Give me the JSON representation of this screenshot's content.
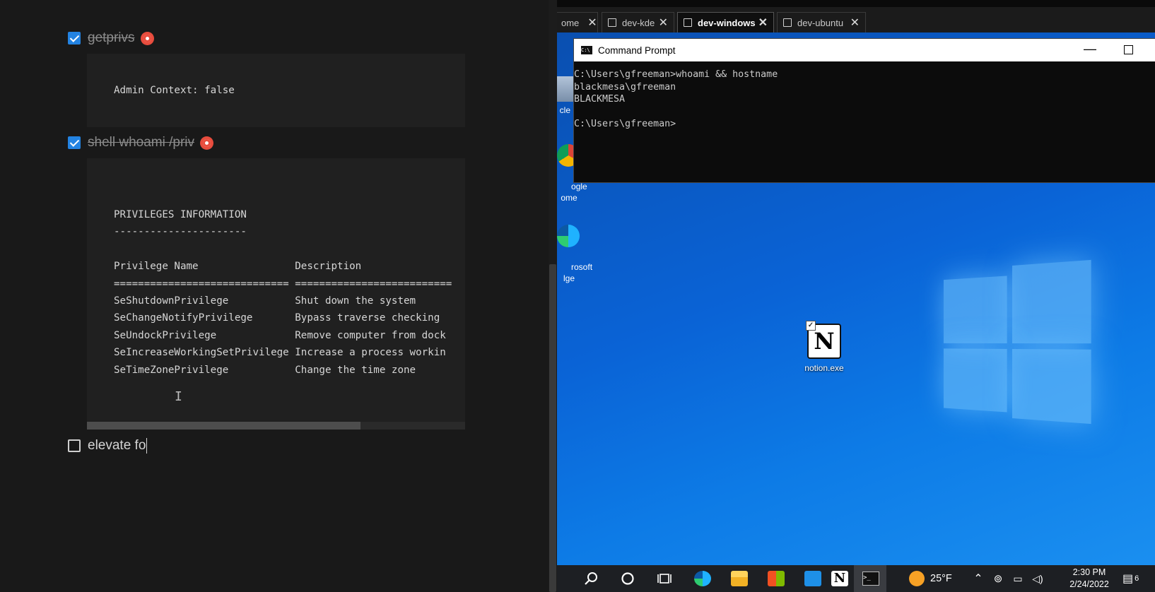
{
  "notes": {
    "todos": [
      {
        "label": "getprivs",
        "checked": true
      },
      {
        "label": "shell whoami /priv",
        "checked": true
      },
      {
        "label": "elevate fo",
        "checked": false
      }
    ],
    "code1": "Admin Context: false",
    "code2": "PRIVILEGES INFORMATION\n----------------------\n\nPrivilege Name                Description\n============================= ==========================\nSeShutdownPrivilege           Shut down the system\nSeChangeNotifyPrivilege       Bypass traverse checking\nSeUndockPrivilege             Remove computer from dock\nSeIncreaseWorkingSetPrivilege Increase a process workin\nSeTimeZonePrivilege           Change the time zone"
  },
  "vm": {
    "tabs": [
      {
        "label": "ome"
      },
      {
        "label": "dev-kde"
      },
      {
        "label": "dev-windows",
        "active": true
      },
      {
        "label": "dev-ubuntu"
      }
    ],
    "cmd": {
      "title": "Command Prompt",
      "output": "C:\\Users\\gfreeman>whoami && hostname\nblackmesa\\gfreeman\nBLACKMESA\n\nC:\\Users\\gfreeman>"
    },
    "desktop_icons": [
      {
        "label": "cle B"
      },
      {
        "label": "ogle\nome"
      },
      {
        "label": "rosoft\nlge"
      }
    ],
    "notion_icon_label": "notion.exe",
    "taskbar": {
      "temperature": "25°F",
      "time": "2:30 PM",
      "date": "2/24/2022",
      "notification_count": "6"
    }
  },
  "colors": {
    "notes_bg": "#191919",
    "code_bg": "#202020",
    "checkbox": "#2383e2",
    "desktop_blue": "#0a63d6",
    "taskbar": "#1d1f23"
  }
}
